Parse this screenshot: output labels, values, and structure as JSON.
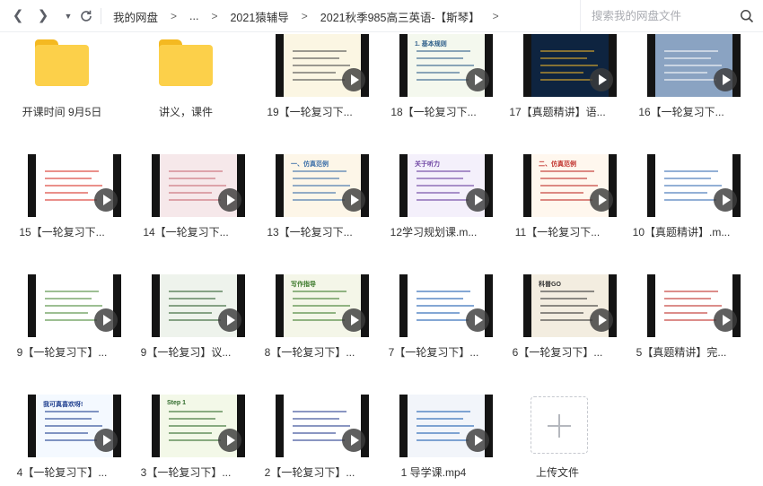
{
  "toolbar": {
    "back_icon": "chevron-left-icon",
    "forward_icon": "chevron-right-icon",
    "history_icon": "caret-down-icon",
    "refresh_icon": "refresh-icon"
  },
  "breadcrumb": [
    "我的网盘",
    "...",
    "2021猿辅导",
    "2021秋季985高三英语-【斯琴】"
  ],
  "breadcrumb_separator": ">",
  "search": {
    "placeholder": "搜索我的网盘文件",
    "icon": "search-icon"
  },
  "files": [
    {
      "label": "开课时间  9月5日",
      "type": "folder"
    },
    {
      "label": "讲义，课件",
      "type": "folder"
    },
    {
      "label": "19【一轮复习下...",
      "type": "video",
      "bg": "#fbf6e3",
      "accent": "#4a4a4a",
      "title": ""
    },
    {
      "label": "18【一轮复习下...",
      "type": "video",
      "bg": "#f4f8ee",
      "accent": "#2f5f8a",
      "title": "1. 基本规则"
    },
    {
      "label": "17【真题精讲】语...",
      "type": "video",
      "bg": "#0e2440",
      "accent": "#e8b12a",
      "title": ""
    },
    {
      "label": "16【一轮复习下...",
      "type": "video",
      "bg": "#8aa3c2",
      "accent": "#ffffff",
      "title": ""
    },
    {
      "label": "15【一轮复习下...",
      "type": "video",
      "bg": "#ffffff",
      "accent": "#d8342c",
      "title": ""
    },
    {
      "label": "14【一轮复习下...",
      "type": "video",
      "bg": "#f6e8ea",
      "accent": "#c86a74",
      "title": ""
    },
    {
      "label": "13【一轮复习下...",
      "type": "video",
      "bg": "#fdf6e8",
      "accent": "#3a6ea8",
      "title": "一、仿真范例"
    },
    {
      "label": "12学习规划课.m...",
      "type": "video",
      "bg": "#f4f0fb",
      "accent": "#6a3fa0",
      "title": "关于听力"
    },
    {
      "label": "11【一轮复习下...",
      "type": "video",
      "bg": "#fff7ee",
      "accent": "#c0302a",
      "title": "二、仿真范例"
    },
    {
      "label": "10【真题精讲】.m...",
      "type": "video",
      "bg": "#ffffff",
      "accent": "#3b6fb5",
      "title": ""
    },
    {
      "label": "9【一轮复习下】...",
      "type": "video",
      "bg": "#ffffff",
      "accent": "#4c8a3a",
      "title": ""
    },
    {
      "label": "9【一轮复习】议...",
      "type": "video",
      "bg": "#eef3ec",
      "accent": "#2f5f2f",
      "title": ""
    },
    {
      "label": "8【一轮复习下】...",
      "type": "video",
      "bg": "#f4f6e8",
      "accent": "#3e7b2c",
      "title": "写作指导"
    },
    {
      "label": "7【一轮复习下】...",
      "type": "video",
      "bg": "#ffffff",
      "accent": "#1f5fb0",
      "title": ""
    },
    {
      "label": "6【一轮复习下】...",
      "type": "video",
      "bg": "#f3ede0",
      "accent": "#333333",
      "title": "科普GO"
    },
    {
      "label": "5【真题精讲】完...",
      "type": "video",
      "bg": "#ffffff",
      "accent": "#c0302a",
      "title": ""
    },
    {
      "label": "4【一轮复习下】...",
      "type": "video",
      "bg": "#f4f9ff",
      "accent": "#1f3f8f",
      "title": "我可真喜欢呀!"
    },
    {
      "label": "3【一轮复习下】...",
      "type": "video",
      "bg": "#f3f8e8",
      "accent": "#2f6a2a",
      "title": "Step 1"
    },
    {
      "label": "2【一轮复习下】...",
      "type": "video",
      "bg": "#ffffff",
      "accent": "#2a3f8f",
      "title": ""
    },
    {
      "label": "1 导学课.mp4",
      "type": "video",
      "bg": "#f2f5fa",
      "accent": "#1f5fb0",
      "title": ""
    },
    {
      "label": "上传文件",
      "type": "upload"
    }
  ]
}
